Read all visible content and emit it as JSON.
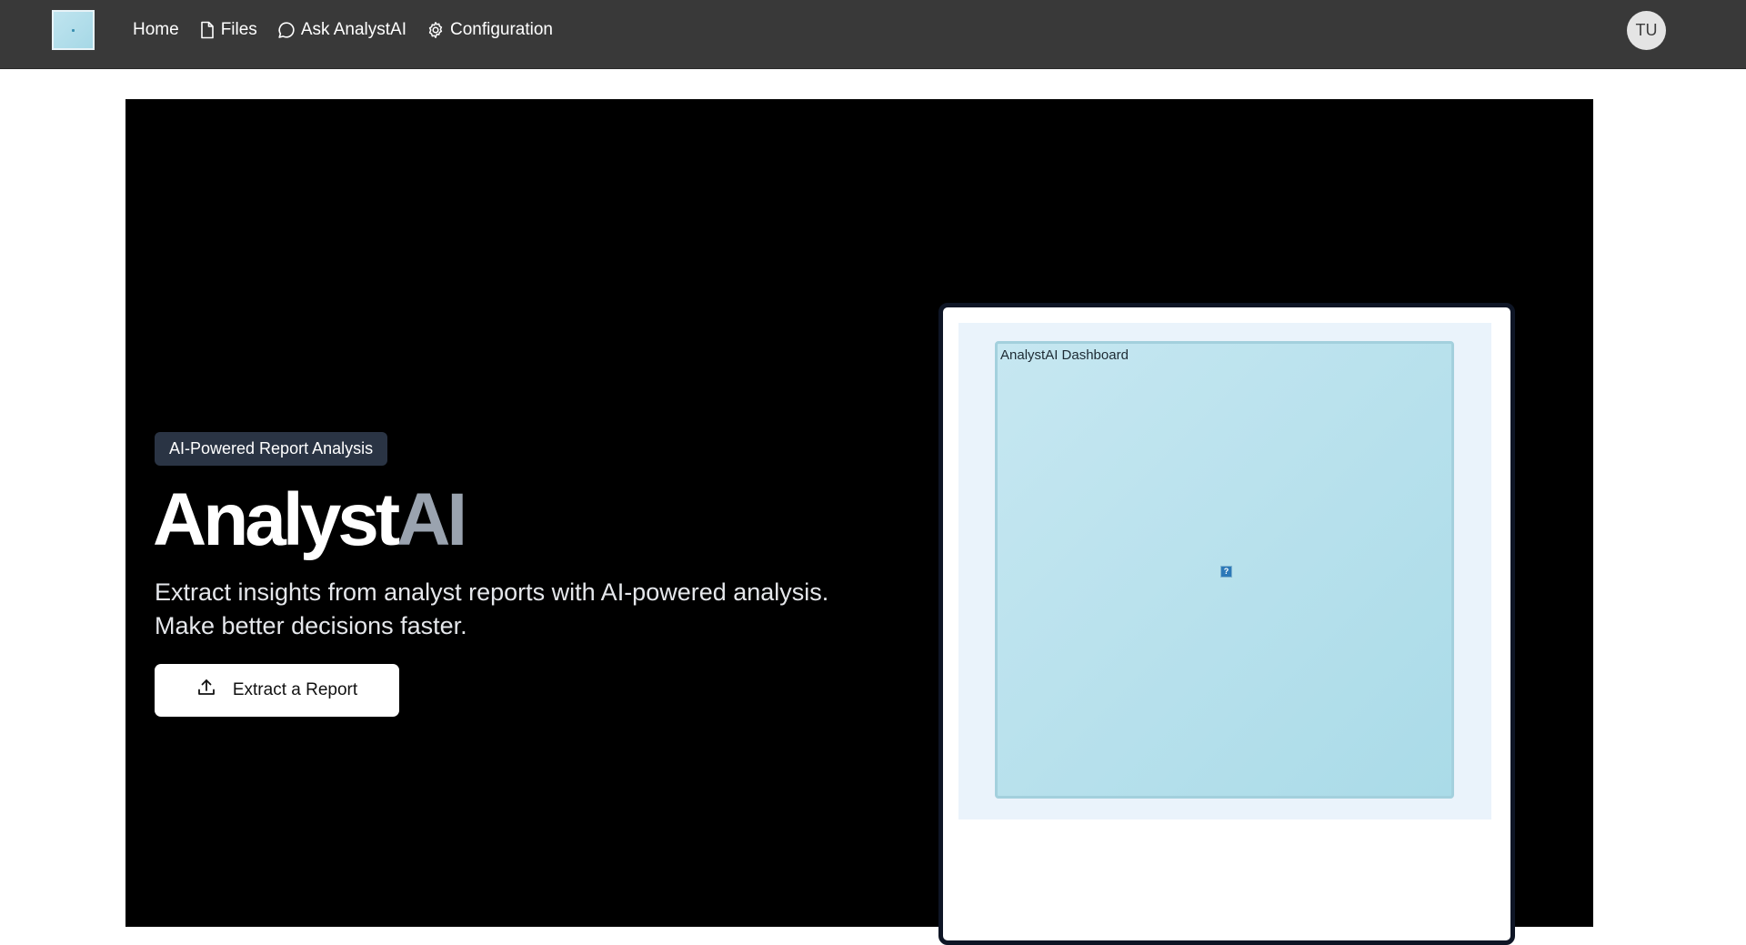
{
  "nav": {
    "links": [
      {
        "label": "Home",
        "icon": ""
      },
      {
        "label": "Files",
        "icon": "file-icon"
      },
      {
        "label": "Ask AnalystAI",
        "icon": "chat-bubble-icon"
      },
      {
        "label": "Configuration",
        "icon": "gear-icon"
      }
    ],
    "avatar_initials": "TU"
  },
  "hero": {
    "badge": "AI-Powered Report Analysis",
    "title_main": "Analyst",
    "title_accent": "AI",
    "subtitle_line1": "Extract insights from analyst reports with AI-powered analysis.",
    "subtitle_line2": "Make better decisions faster.",
    "cta_label": "Extract a Report",
    "cta_icon": "upload-icon"
  },
  "preview": {
    "dashboard_title": "AnalystAI Dashboard",
    "image_placeholder": "?"
  },
  "colors": {
    "navbar": "#393939",
    "hero_bg": "#000000",
    "title_accent": "#9aa3af",
    "badge_bg": "#2a3444",
    "preview_bg": "#eaf3fb",
    "dashboard_bg": "#b6e0eb"
  }
}
